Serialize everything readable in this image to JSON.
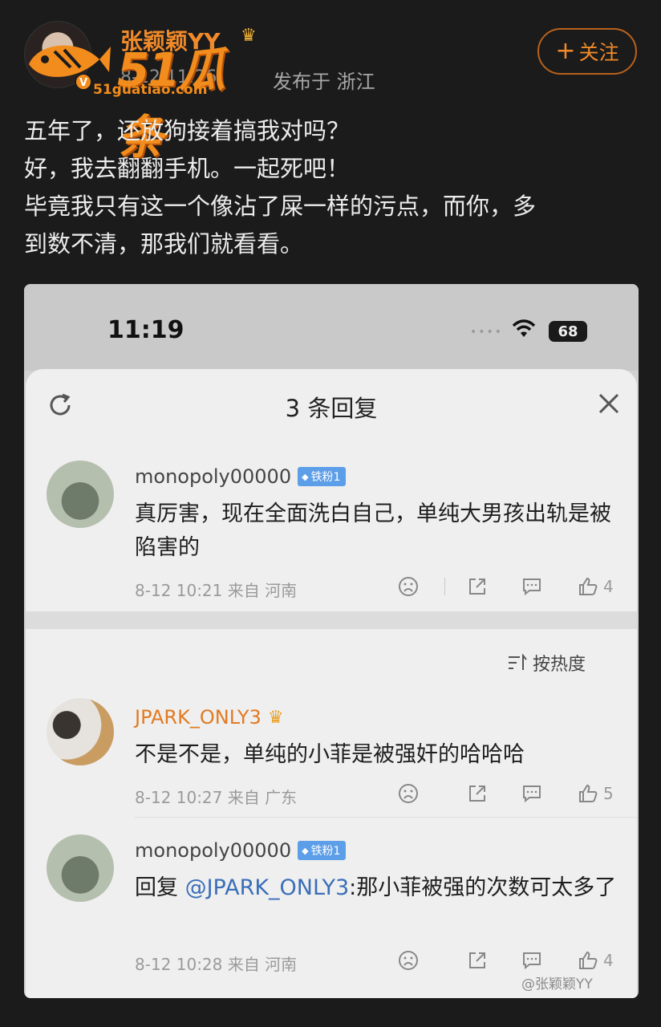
{
  "post": {
    "author": "张颖颖YY",
    "time_partial": "8-12 11:26",
    "from": "发布于 浙江",
    "follow_label": "关注",
    "lines": [
      "五年了，还放狗接着搞我对吗？",
      "好，我去翻翻手机。一起死吧！",
      "毕竟我只有这一个像沾了屎一样的污点，而你，多",
      "到数不清，那我们就看看。"
    ]
  },
  "watermark": {
    "logo_text": "51瓜条",
    "logo_url": "51guatiao.com",
    "corner_text": "@张颖颖YY"
  },
  "screenshot": {
    "status": {
      "time": "11:19",
      "signal_dots": "••••",
      "battery": "68"
    },
    "sheet_title": "3 条回复",
    "sort_label": "按热度",
    "comments": [
      {
        "user": "monopoly00000",
        "badge": "铁粉1",
        "text": "真厉害，现在全面洗白自己，单纯大男孩出轨是被陷害的",
        "meta": "8-12 10:21  来自 河南",
        "likes": "4"
      },
      {
        "user": "JPARK_ONLY3",
        "text": "不是不是，单纯的小菲是被强奸的哈哈哈",
        "meta": "8-12 10:27  来自 广东",
        "likes": "5"
      },
      {
        "user": "monopoly00000",
        "badge": "铁粉1",
        "reply_prefix": "回复",
        "mention": "@JPARK_ONLY3",
        "text": ":那小菲被强的次数可太多了",
        "meta": "8-12 10:28  来自 河南",
        "likes": "4"
      }
    ]
  }
}
